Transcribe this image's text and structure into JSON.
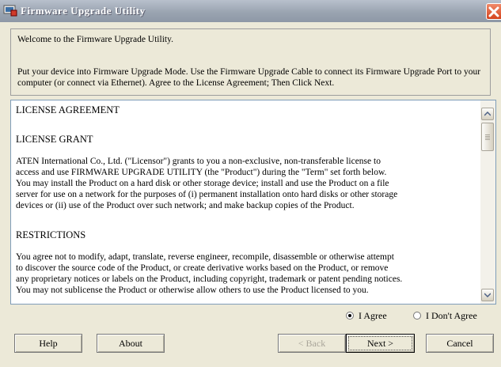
{
  "window": {
    "title": "Firmware Upgrade Utility"
  },
  "welcome": {
    "line1": "Welcome to the Firmware Upgrade Utility.",
    "line2": "Put your device into Firmware Upgrade Mode. Use the Firmware Upgrade Cable to connect its Firmware Upgrade Port to your computer (or connect via Ethernet). Agree to the License Agreement; Then Click Next."
  },
  "license": {
    "title": "LICENSE AGREEMENT",
    "grant_heading": "LICENSE GRANT",
    "grant_lines": [
      "ATEN International Co., Ltd. (\"Licensor\") grants to you a non-exclusive, non-transferable license to",
      "access and use FIRMWARE UPGRADE UTILITY (the \"Product\") during the \"Term\" set forth below.",
      "You may install the Product on a hard disk or other storage device; install and use the Product on a file",
      "server for use on a network for the purposes of (i) permanent installation onto hard disks or other storage",
      "devices or (ii) use of the Product over such network; and make backup copies of the Product."
    ],
    "restrictions_heading": "RESTRICTIONS",
    "restrictions_lines": [
      "You agree not to modify, adapt, translate, reverse engineer, recompile, disassemble or otherwise attempt",
      "to discover the source code of the Product, or create derivative works based on the Product, or remove",
      "any proprietary notices or labels on the Product, including copyright, trademark or patent pending notices.",
      "You may not sublicense the Product or otherwise allow others to use the Product licensed to you."
    ]
  },
  "agreement": {
    "agree_label": "I Agree",
    "disagree_label": "I Don't Agree",
    "selected": "agree"
  },
  "buttons": {
    "help": "Help",
    "about": "About",
    "back": "< Back",
    "next": "Next >",
    "cancel": "Cancel"
  }
}
